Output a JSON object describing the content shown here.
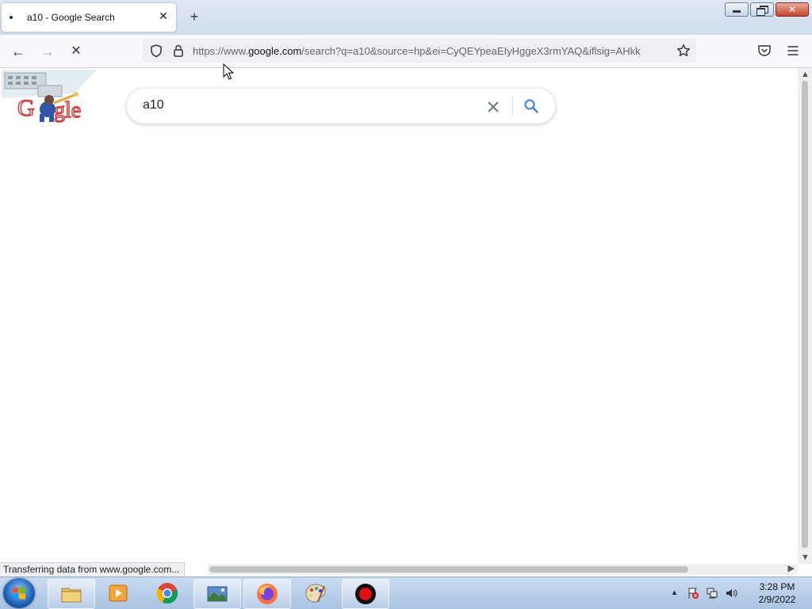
{
  "tab": {
    "title": "a10 - Google Search",
    "close_symbol": "✕",
    "new_tab_symbol": "+"
  },
  "window": {
    "close_symbol": "✕"
  },
  "nav": {
    "back_symbol": "←",
    "forward_symbol": "→",
    "stop_symbol": "✕",
    "url_prefix": "https://www.",
    "url_domain": "google.com",
    "url_rest": "/search?q=a10&source=hp&ei=CyQEYpeaEIyHggeX3rmYAQ&iflsig=AHkk"
  },
  "search": {
    "query": "a10"
  },
  "status": {
    "text": "Transferring data from www.google.com..."
  },
  "scroll": {
    "up_symbol": "▲",
    "down_symbol": "▼",
    "right_symbol": "▶"
  },
  "tray": {
    "arrow_symbol": "▲"
  },
  "clock": {
    "time": "3:28 PM",
    "date": "2/9/2022"
  },
  "icons": {
    "shield": "shield-icon",
    "lock": "lock-icon",
    "star": "bookmark-star-icon",
    "pocket": "pocket-icon",
    "menu": "hamburger-menu-icon"
  }
}
